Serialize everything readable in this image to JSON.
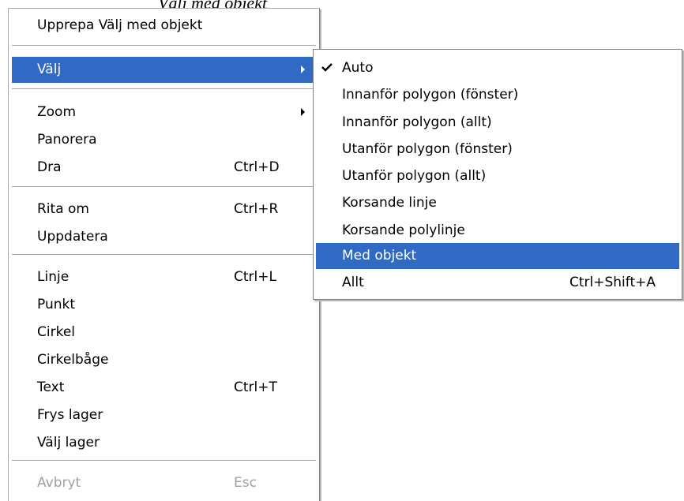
{
  "header_text": "Välj med objekt",
  "main_menu": {
    "repeat_label": "Upprepa Välj med objekt",
    "select_label": "Välj",
    "zoom_label": "Zoom",
    "pan_label": "Panorera",
    "drag_label": "Dra",
    "drag_shortcut": "Ctrl+D",
    "redraw_label": "Rita om",
    "redraw_shortcut": "Ctrl+R",
    "update_label": "Uppdatera",
    "line_label": "Linje",
    "line_shortcut": "Ctrl+L",
    "point_label": "Punkt",
    "circle_label": "Cirkel",
    "arc_label": "Cirkelbåge",
    "text_label": "Text",
    "text_shortcut": "Ctrl+T",
    "freeze_label": "Frys lager",
    "select_layer_label": "Välj lager",
    "cancel_label": "Avbryt",
    "cancel_shortcut": "Esc"
  },
  "select_submenu": {
    "auto_label": "Auto",
    "inside_window_label": "Innanför polygon (fönster)",
    "inside_all_label": "Innanför polygon (allt)",
    "outside_window_label": "Utanför polygon (fönster)",
    "outside_all_label": "Utanför polygon (allt)",
    "crossing_line_label": "Korsande linje",
    "crossing_polyline_label": "Korsande polylinje",
    "with_object_label": "Med objekt",
    "all_label": "Allt",
    "all_shortcut": "Ctrl+Shift+A"
  },
  "colors": {
    "highlight": "#316ac5",
    "disabled_text": "#a0a0a0"
  },
  "icons": [
    "checkmark-icon",
    "submenu-arrow-icon"
  ]
}
